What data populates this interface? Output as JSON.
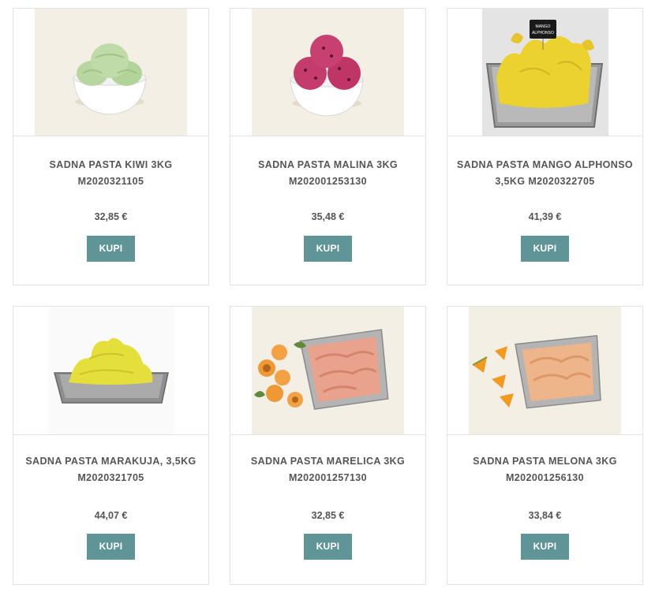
{
  "products": [
    {
      "title": "SADNA PASTA KIWI 3KG M2020321105",
      "price": "32,85 €",
      "button": "KUPI",
      "image": "kiwi-gelato-bowl-image",
      "color": "#b9d9a3"
    },
    {
      "title": "SADNA PASTA MALINA 3KG M202001253130",
      "price": "35,48 €",
      "button": "KUPI",
      "image": "raspberry-gelato-bowl-image",
      "color": "#c23a6a"
    },
    {
      "title": "SADNA PASTA MANGO ALPHONSO 3,5KG M2020322705",
      "price": "41,39 €",
      "button": "KUPI",
      "image": "mango-gelato-tray-image",
      "color": "#ecd22f"
    },
    {
      "title": "SADNA PASTA MARAKUJA, 3,5KG M2020321705",
      "price": "44,07 €",
      "button": "KUPI",
      "image": "passionfruit-gelato-tray-image",
      "color": "#e6e040"
    },
    {
      "title": "SADNA PASTA MARELICA 3KG M202001257130",
      "price": "32,85 €",
      "button": "KUPI",
      "image": "apricot-gelato-tray-image",
      "color": "#e9a38d"
    },
    {
      "title": "SADNA PASTA MELONA 3KG M202001256130",
      "price": "33,84 €",
      "button": "KUPI",
      "image": "melon-gelato-tray-image",
      "color": "#eeb58a"
    }
  ],
  "mango_sign": "MANGO ALPHONSO",
  "button_color": "#5f9597"
}
